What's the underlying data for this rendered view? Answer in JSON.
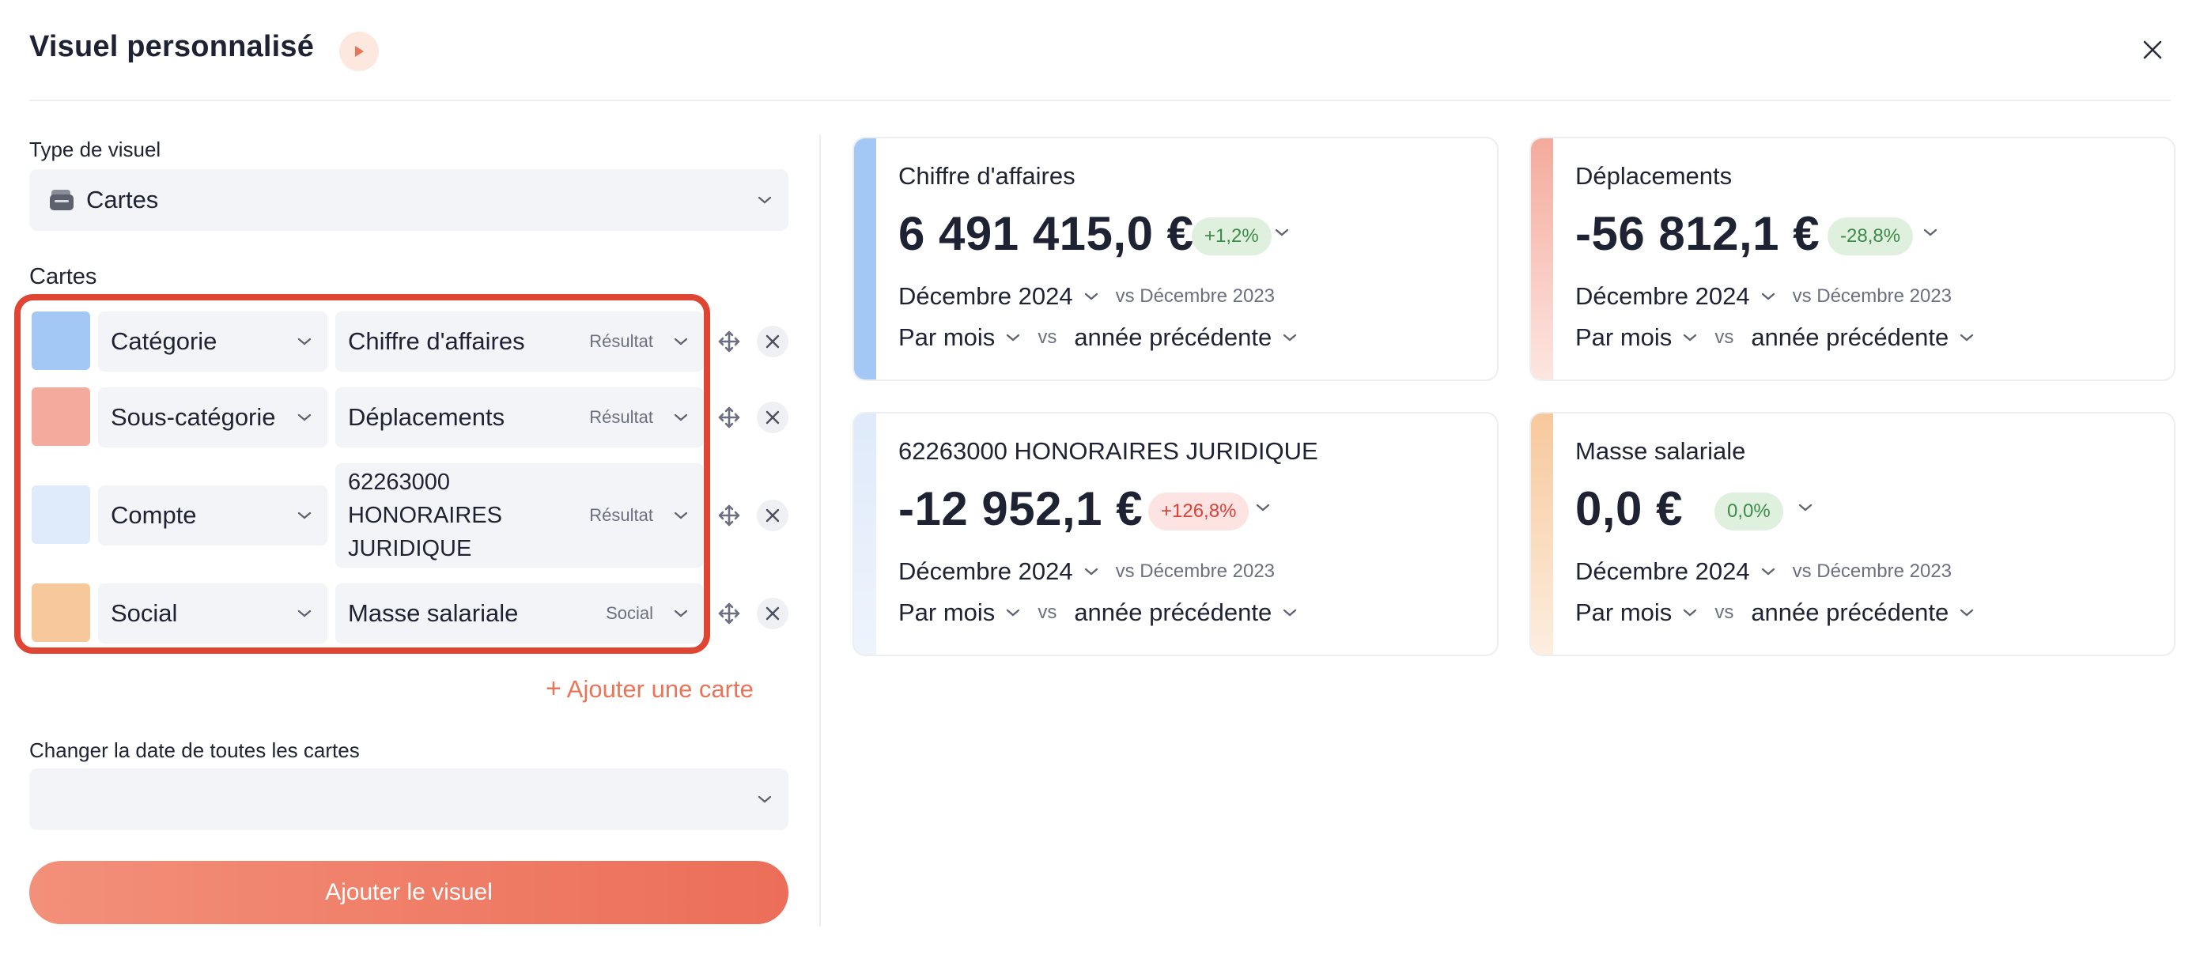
{
  "header": {
    "title": "Visuel personnalisé"
  },
  "form": {
    "type_label": "Type de visuel",
    "type_value": "Cartes",
    "cards_label": "Cartes",
    "add_card_label": "Ajouter une carte",
    "change_date_label": "Changer la date de toutes les cartes",
    "change_date_value": "",
    "submit_label": "Ajouter le visuel"
  },
  "rows": [
    {
      "color": "#a3c8f6",
      "type": "Catégorie",
      "item": "Chiffre d'affaires",
      "tag": "Résultat"
    },
    {
      "color": "#f4aa9c",
      "type": "Sous-catégorie",
      "item": "Déplacements",
      "tag": "Résultat"
    },
    {
      "color": "#dfeafa",
      "type": "Compte",
      "item_lines": [
        "62263000",
        "HONORAIRES",
        "JURIDIQUE"
      ],
      "tag": "Résultat"
    },
    {
      "color": "#f7c89c",
      "type": "Social",
      "item": "Masse salariale",
      "tag": "Social"
    }
  ],
  "cards": [
    {
      "title": "Chiffre d'affaires",
      "value": "6 491 415,0 €",
      "badge": "+1,2%",
      "badge_type": "pos",
      "color": "#a3c8f6",
      "period": "Décembre 2024",
      "compare": "vs Décembre 2023",
      "granularity": "Par mois",
      "vs": "vs",
      "reference": "année précédente"
    },
    {
      "title": "Déplacements",
      "value": "-56 812,1 €",
      "badge": "-28,8%",
      "badge_type": "pos",
      "color": "#f4aa9c",
      "period": "Décembre 2024",
      "compare": "vs Décembre 2023",
      "granularity": "Par mois",
      "vs": "vs",
      "reference": "année précédente"
    },
    {
      "title": "62263000 HONORAIRES JURIDIQUE",
      "value": "-12 952,1 €",
      "badge": "+126,8%",
      "badge_type": "neg",
      "color": "#dfeafa",
      "period": "Décembre 2024",
      "compare": "vs Décembre 2023",
      "granularity": "Par mois",
      "vs": "vs",
      "reference": "année précédente"
    },
    {
      "title": "Masse salariale",
      "value": "0,0 €",
      "badge": "0,0%",
      "badge_type": "pos",
      "color": "#f7c89c",
      "period": "Décembre 2024",
      "compare": "vs Décembre 2023",
      "granularity": "Par mois",
      "vs": "vs",
      "reference": "année précédente"
    }
  ],
  "colors": {
    "accent": "#ec6e58",
    "highlight": "#e04433"
  }
}
